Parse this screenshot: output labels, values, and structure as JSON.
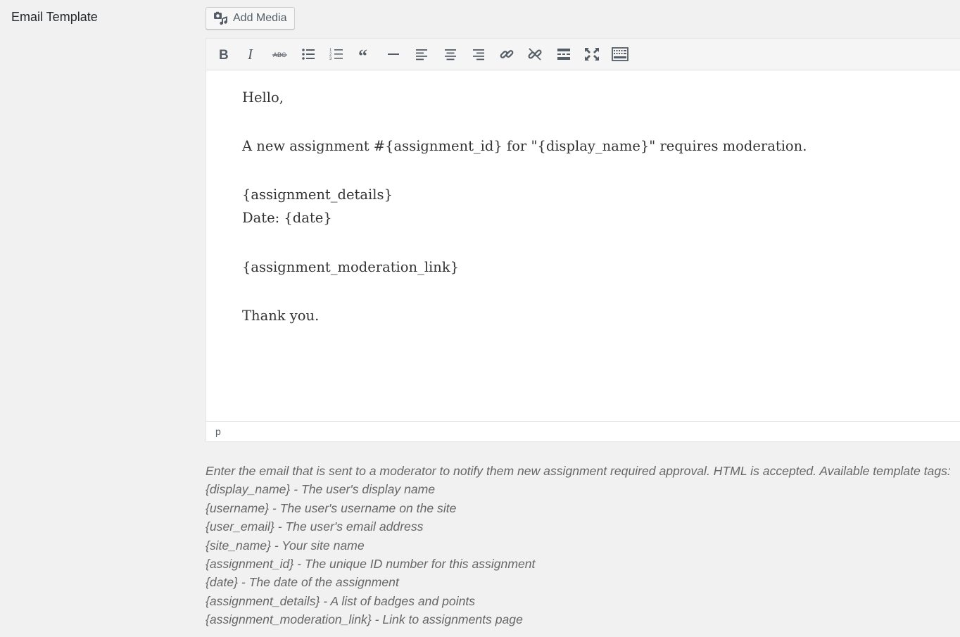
{
  "field": {
    "label": "Email Template"
  },
  "add_media": {
    "label": "Add Media",
    "icon": "add-media-icon"
  },
  "toolbar": {
    "buttons": [
      {
        "name": "bold",
        "icon": "bold-icon"
      },
      {
        "name": "italic",
        "icon": "italic-icon"
      },
      {
        "name": "strikethrough",
        "icon": "strikethrough-icon"
      },
      {
        "name": "bulleted-list",
        "icon": "bulleted-list-icon"
      },
      {
        "name": "numbered-list",
        "icon": "numbered-list-icon"
      },
      {
        "name": "blockquote",
        "icon": "blockquote-icon"
      },
      {
        "name": "horizontal-line",
        "icon": "horizontal-line-icon"
      },
      {
        "name": "align-left",
        "icon": "align-left-icon"
      },
      {
        "name": "align-center",
        "icon": "align-center-icon"
      },
      {
        "name": "align-right",
        "icon": "align-right-icon"
      },
      {
        "name": "insert-link",
        "icon": "link-icon"
      },
      {
        "name": "remove-link",
        "icon": "unlink-icon"
      },
      {
        "name": "read-more",
        "icon": "read-more-icon"
      },
      {
        "name": "fullscreen",
        "icon": "fullscreen-icon"
      },
      {
        "name": "toolbar-toggle",
        "icon": "keyboard-icon"
      }
    ]
  },
  "editor": {
    "lines": [
      "Hello,",
      "A new assignment #{assignment_id} for \"{display_name}\" requires moderation.",
      "{assignment_details}",
      "Date: {date}",
      "{assignment_moderation_link}",
      "Thank you."
    ],
    "status_path": "p"
  },
  "description": {
    "intro": "Enter the email that is sent to a moderator to notify them new assignment required approval. HTML is accepted. Available template tags:",
    "tags": [
      "{display_name} - The user's display name",
      "{username} - The user's username on the site",
      "{user_email} - The user's email address",
      "{site_name} - Your site name",
      "{assignment_id} - The unique ID number for this assignment",
      "{date} - The date of the assignment",
      "{assignment_details} - A list of badges and points",
      "{assignment_moderation_link} - Link to assignments page"
    ]
  },
  "colors": {
    "page_bg": "#f1f1f1",
    "toolbar_bg": "#f5f5f5",
    "icon": "#555d66",
    "editor_text": "#333333",
    "description_text": "#666666"
  }
}
